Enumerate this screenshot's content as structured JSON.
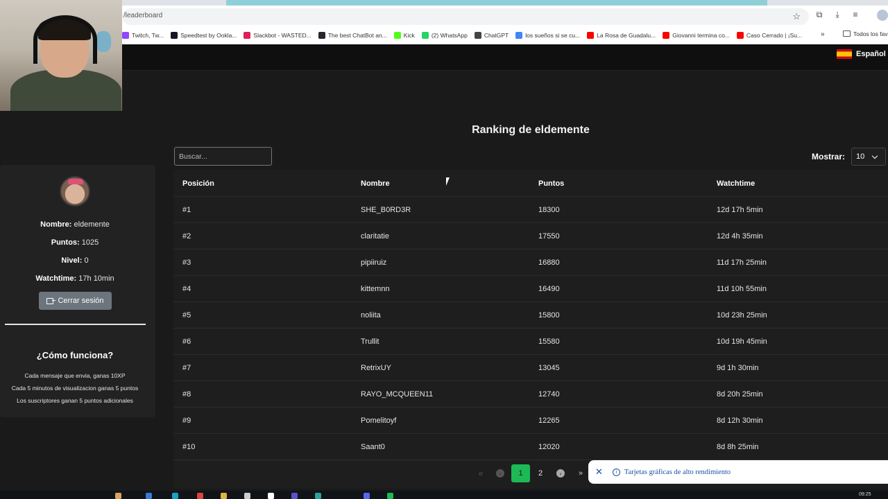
{
  "browser": {
    "url": "/leaderboard",
    "bookmarks": [
      {
        "label": "Twitch, Tw...",
        "color": "#9146ff"
      },
      {
        "label": "Speedtest by Ookla...",
        "color": "#141526"
      },
      {
        "label": "Slackbot - WASTED...",
        "color": "#e01e5a"
      },
      {
        "label": "The best ChatBot an...",
        "color": "#24292e"
      },
      {
        "label": "Kick",
        "color": "#53fc18"
      },
      {
        "label": "(2) WhatsApp",
        "color": "#25d366"
      },
      {
        "label": "ChatGPT",
        "color": "#444444"
      },
      {
        "label": "los sueños si se cu...",
        "color": "#4285f4"
      },
      {
        "label": "La Rosa de Guadalu...",
        "color": "#ff0000"
      },
      {
        "label": "Giovanni termina co...",
        "color": "#ff0000"
      },
      {
        "label": "Caso Cerrado | ¡Su...",
        "color": "#ff0000"
      }
    ],
    "all_bookmarks": "Todos los fav"
  },
  "site": {
    "language": "Español"
  },
  "profile": {
    "name_label": "Nombre:",
    "name": "eldemente",
    "points_label": "Puntos:",
    "points": "1025",
    "level_label": "Nivel:",
    "level": "0",
    "watchtime_label": "Watchtime:",
    "watchtime": "17h 10min",
    "logout_label": "Cerrar sesión"
  },
  "howto": {
    "title": "¿Cómo funciona?",
    "lines": [
      "Cada mensaje que envia, ganas 10XP",
      "Cada 5 minutos de visualizacion ganas 5 puntos",
      "Los suscriptores ganan 5 puntos adicionales"
    ]
  },
  "leaderboard": {
    "title": "Ranking de eldemente",
    "search_placeholder": "Buscar...",
    "show_label": "Mostrar:",
    "show_value": "10",
    "columns": [
      "Posición",
      "Nombre",
      "Puntos",
      "Watchtime"
    ],
    "rows": [
      [
        "#1",
        "SHE_B0RD3R",
        "18300",
        "12d 17h 5min"
      ],
      [
        "#2",
        "claritatie",
        "17550",
        "12d 4h 35min"
      ],
      [
        "#3",
        "pipiiruiz",
        "16880",
        "11d 17h 25min"
      ],
      [
        "#4",
        "kittemnn",
        "16490",
        "11d 10h 55min"
      ],
      [
        "#5",
        "noliita",
        "15800",
        "10d 23h 25min"
      ],
      [
        "#6",
        "Trullit",
        "15580",
        "10d 19h 45min"
      ],
      [
        "#7",
        "RetrixUY",
        "13045",
        "9d 1h 30min"
      ],
      [
        "#8",
        "RAYO_MCQUEEN11",
        "12740",
        "8d 20h 25min"
      ],
      [
        "#9",
        "Pomelitoyf",
        "12265",
        "8d 12h 30min"
      ],
      [
        "#10",
        "Saant0",
        "12020",
        "8d 8h 25min"
      ]
    ]
  },
  "pagination": {
    "first": "«",
    "prev": "‹",
    "pages": [
      "1",
      "2"
    ],
    "active": "1",
    "next": "›",
    "last": "»"
  },
  "notification": {
    "text": "Tarjetas gráficas de alto rendimiento"
  },
  "taskbar": {
    "clock": "09:25"
  }
}
